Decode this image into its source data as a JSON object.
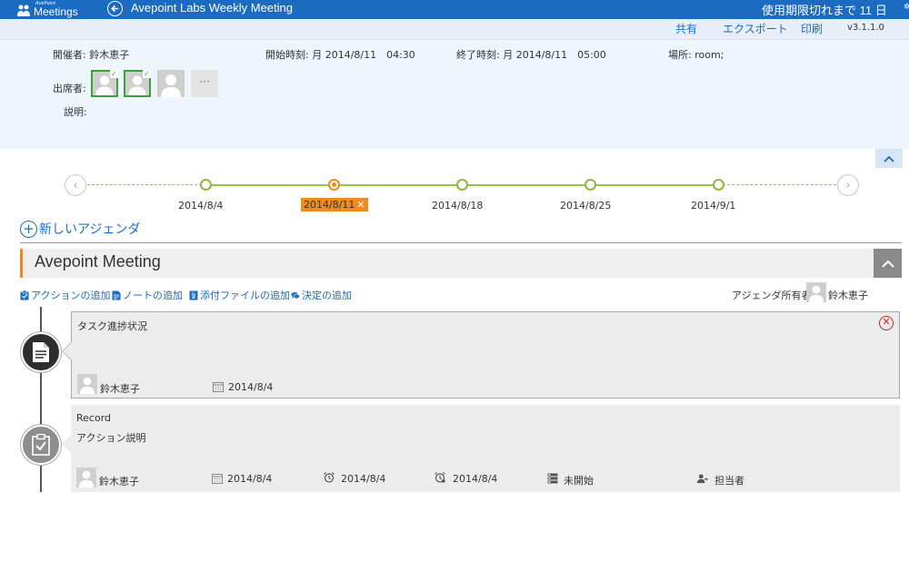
{
  "topbar": {
    "logo_small": "AvePoint",
    "logo_big": "Meetings",
    "title": "Avepoint Labs Weekly Meeting",
    "expiry": "使用期限切れまで 11 日"
  },
  "toolbar": {
    "share": "共有",
    "export": "エクスポート",
    "print": "印刷",
    "version": "v3.1.1.0"
  },
  "meeting": {
    "organizer": "開催者: 鈴木恵子",
    "start": "開始時刻: 月 2014/8/11　04:30",
    "end": "終了時刻: 月 2014/8/11　05:00",
    "location": "場所: room;",
    "attendees_label": "出席者:",
    "more": "···",
    "description_label": "説明:"
  },
  "timeline": {
    "dates": [
      "2014/8/4",
      "2014/8/11",
      "2014/8/18",
      "2014/8/25",
      "2014/9/1"
    ],
    "active_index": 1,
    "active_close": "✕"
  },
  "new_agenda": "新しいアジェンダ",
  "agenda": {
    "title": "Avepoint Meeting",
    "add_action": "アクションの追加",
    "add_note": "ノートの追加",
    "add_attachment": "添付ファイルの追加",
    "add_decision": "決定の追加",
    "owner_label": "アジェンダ所有者:",
    "owner_name": "鈴木恵子"
  },
  "items": [
    {
      "title": "タスク進捗状況",
      "user": "鈴木恵子",
      "date": "2014/8/4"
    },
    {
      "title": "Record",
      "subtitle": "アクション説明",
      "user": "鈴木恵子",
      "date": "2014/8/4",
      "start_date": "2014/8/4",
      "due_date": "2014/8/4",
      "status": "未開始",
      "assignee": "担当者"
    }
  ],
  "colors": {
    "brand": "#1c6bc3",
    "accent": "#ef8a1f",
    "timeline": "#8fb63d",
    "delete": "#d32020"
  }
}
